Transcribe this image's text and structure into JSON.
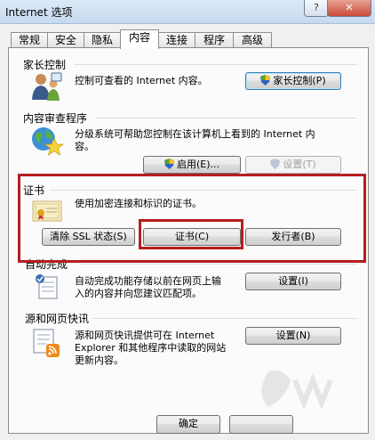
{
  "window": {
    "title": "Internet 选项",
    "help_glyph": "?",
    "close_glyph": "✕"
  },
  "tabs": [
    {
      "label": "常规"
    },
    {
      "label": "安全"
    },
    {
      "label": "隐私"
    },
    {
      "label": "内容",
      "active": true
    },
    {
      "label": "连接"
    },
    {
      "label": "程序"
    },
    {
      "label": "高级"
    }
  ],
  "parental": {
    "title": "家长控制",
    "desc": "控制可查看的 Internet 内容。",
    "button": "家长控制(P)"
  },
  "advisor": {
    "title": "内容审查程序",
    "desc_line1": "分级系统可帮助您控制在该计算机上看到的 Internet 内",
    "desc_line2": "容。",
    "enable_button": "启用(E)...",
    "settings_button": "设置(T)"
  },
  "certificates": {
    "title": "证书",
    "desc": "使用加密连接和标识的证书。",
    "clear_ssl_button": "清除 SSL 状态(S)",
    "certificates_button": "证书(C)",
    "publishers_button": "发行者(B)"
  },
  "autocomplete": {
    "title": "自动完成",
    "desc_line1": "自动完成功能存储以前在网页上输",
    "desc_line2": "入的内容并向您建议匹配项。",
    "settings_button": "设置(I)"
  },
  "feeds": {
    "title": "源和网页快讯",
    "desc_line1": "源和网页快讯提供可在 Internet",
    "desc_line2": "Explorer 和其他程序中读取的网站",
    "desc_line3": "更新内容。",
    "settings_button": "设置(N)"
  },
  "footer": {
    "ok_button": "确定"
  },
  "colors": {
    "highlight_border": "#b41e1e",
    "default_button_border": "#3c7fb1"
  }
}
